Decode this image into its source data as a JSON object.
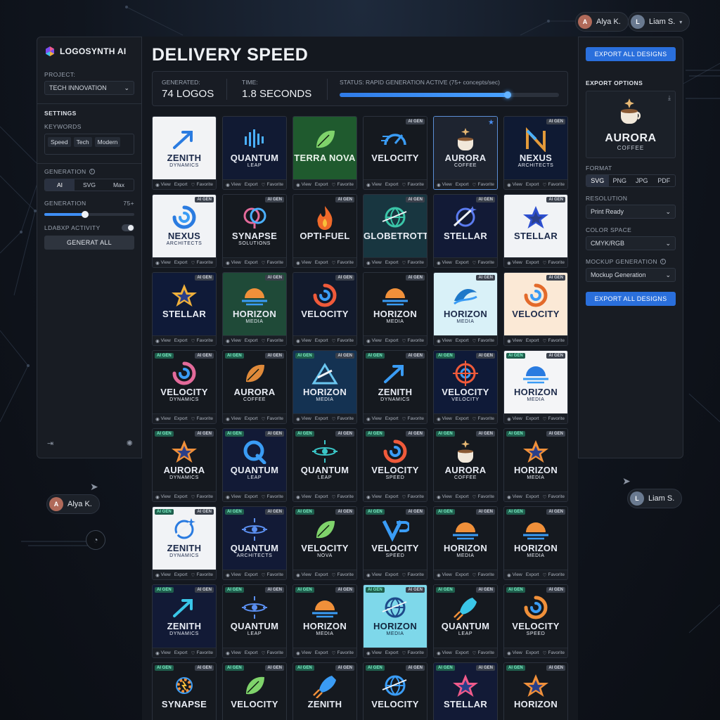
{
  "presence": {
    "top_users": [
      {
        "name": "Alya K."
      },
      {
        "name": "Liam S."
      }
    ],
    "bottom_left": "Alya K.",
    "bottom_right": "Liam S."
  },
  "sidebar": {
    "brand": "LOGOSYNTH AI",
    "project_label": "PROJECT:",
    "project_value": "TECH INNOVATION",
    "settings_label": "SETTINGS",
    "keywords_label": "KEYWORDS",
    "keywords": [
      "Speed",
      "Tech",
      "Modern"
    ],
    "generation_label": "GENERATION",
    "generation_options": [
      "AI",
      "SVG",
      "Max"
    ],
    "generation_count_label": "GENERATION",
    "generation_count_value": "75+",
    "generation_slider_fraction": 0.45,
    "activity_label": "LDABXP ACTIVITY",
    "generate_button": "GENERAT ALL"
  },
  "main": {
    "title": "DELIVERY SPEED",
    "generated_label": "GENERATED:",
    "generated_value": "74 LOGOS",
    "time_label": "TIME:",
    "time_value": "1.8 SECONDS",
    "status_label": "STATUS: RAPID GENERATION ACTIVE (75+ concepts/sec)",
    "status_progress": 0.77,
    "card_actions": {
      "view": "View",
      "export": "Export",
      "favorite": "Favorite"
    },
    "cards": [
      {
        "name": "ZENITH",
        "sub": "DYNAMICS",
        "bg": "#f2f3f5",
        "fg": "#1c2a4a",
        "accent": "#2a7be0",
        "icon": "arrow"
      },
      {
        "name": "QUANTUM",
        "sub": "LEAP",
        "bg": "#111a33",
        "fg": "#e8ecf4",
        "accent": "#4ab0ff",
        "icon": "bars"
      },
      {
        "name": "TERRA NOVA",
        "sub": "",
        "bg": "#1f5a2e",
        "fg": "#e9f4ea",
        "accent": "#7fd36b",
        "icon": "leaf"
      },
      {
        "name": "VELOCITY",
        "sub": "",
        "bg": "#15191f",
        "fg": "#e8ecf4",
        "accent": "#3a9cf5",
        "icon": "gauge",
        "tag_r": "AI GEN"
      },
      {
        "name": "AURORA",
        "sub": "COFFEE",
        "bg": "#1e2430",
        "fg": "#e8ecf4",
        "accent": "#e7b873",
        "icon": "cup",
        "selected": true
      },
      {
        "name": "NEXUS",
        "sub": "ARCHITECTS",
        "bg": "#0f1a33",
        "fg": "#e8ecf4",
        "accent": "#e39a3a",
        "icon": "n",
        "tag_r": "AI GEN"
      },
      {
        "name": "NEXUS",
        "sub": "ARCHITECTS",
        "bg": "#f1f3f6",
        "fg": "#1c2a4a",
        "accent": "#2a7be0",
        "icon": "swirl",
        "tag_r": "AI GEN"
      },
      {
        "name": "SYNAPSE",
        "sub": "SOLUTIONS",
        "bg": "#15191f",
        "fg": "#e8ecf4",
        "accent": "#e36a9a",
        "icon": "brain",
        "tag_r": "AI GEN"
      },
      {
        "name": "OPTI-FUEL",
        "sub": "",
        "bg": "#15191f",
        "fg": "#e8ecf4",
        "accent": "#f06a2a",
        "icon": "flame",
        "tag_r": "AI GEN"
      },
      {
        "name": "GLOBETROTTER",
        "sub": "",
        "bg": "#183640",
        "fg": "#e8ecf4",
        "accent": "#3ac6a8",
        "icon": "globe",
        "tag_r": "AI GEN"
      },
      {
        "name": "STELLAR",
        "sub": "",
        "bg": "#121a36",
        "fg": "#e8ecf4",
        "accent": "#5b7bf0",
        "icon": "orbit",
        "tag_r": "AI GEN"
      },
      {
        "name": "STELLAR",
        "sub": "",
        "bg": "#f1f3f6",
        "fg": "#1c2a4a",
        "accent": "#2d4fd0",
        "icon": "star",
        "tag_r": "AI GEN"
      },
      {
        "name": "STELLAR",
        "sub": "",
        "bg": "#0f1a38",
        "fg": "#e8ecf4",
        "accent": "#f0b03a",
        "icon": "star",
        "tag_r": "AI GEN"
      },
      {
        "name": "HORIZON",
        "sub": "MEDIA",
        "bg": "#1f4a38",
        "fg": "#e8ecf4",
        "accent": "#f0903a",
        "icon": "sun",
        "tag_r": "AI GEN"
      },
      {
        "name": "VELOCITY",
        "sub": "",
        "bg": "#121a2c",
        "fg": "#e8ecf4",
        "accent": "#f05a3a",
        "icon": "swirl",
        "tag_r": "AI GEN"
      },
      {
        "name": "HORIZON",
        "sub": "MEDIA",
        "bg": "#15191f",
        "fg": "#e8ecf4",
        "accent": "#f0903a",
        "icon": "sun",
        "tag_r": "AI GEN"
      },
      {
        "name": "HORIZON",
        "sub": "MEDIA",
        "bg": "#d9f1f8",
        "fg": "#1c2a4a",
        "accent": "#1e78c8",
        "icon": "wave",
        "tag_r": "AI GEN"
      },
      {
        "name": "VELOCITY",
        "sub": "",
        "bg": "#fbe9d6",
        "fg": "#1c2a4a",
        "accent": "#e36a2a",
        "icon": "swirl",
        "tag_r": "AI GEN"
      },
      {
        "name": "VELOCITY",
        "sub": "DYNAMICS",
        "bg": "#15191f",
        "fg": "#e8ecf4",
        "accent": "#e36a9a",
        "icon": "swirl",
        "tag_l": "AI GEN",
        "tag_r": "AI GEN"
      },
      {
        "name": "AURORA",
        "sub": "COFFEE",
        "bg": "#15191f",
        "fg": "#e8ecf4",
        "accent": "#e08a3a",
        "icon": "leaf",
        "tag_l": "AI GEN",
        "tag_r": "AI GEN"
      },
      {
        "name": "HORIZON",
        "sub": "MEDIA",
        "bg": "#143252",
        "fg": "#e8ecf4",
        "accent": "#6ac6f0",
        "icon": "mountain",
        "tag_l": "AI GEN",
        "tag_r": "AI GEN"
      },
      {
        "name": "ZENITH",
        "sub": "DYNAMICS",
        "bg": "#15191f",
        "fg": "#e8ecf4",
        "accent": "#3a9cf5",
        "icon": "arrow",
        "tag_l": "AI GEN",
        "tag_r": "AI GEN"
      },
      {
        "name": "VELOCITY",
        "sub": "VELOCITY",
        "bg": "#0f1a38",
        "fg": "#e8ecf4",
        "accent": "#f05a3a",
        "icon": "target",
        "tag_l": "AI GEN",
        "tag_r": "AI GEN"
      },
      {
        "name": "HORIZON",
        "sub": "MEDIA",
        "bg": "#f4f5f7",
        "fg": "#1c2a4a",
        "accent": "#2a7be0",
        "icon": "sun",
        "tag_l": "AI GEN",
        "tag_r": "AI GEN"
      },
      {
        "name": "AURORA",
        "sub": "DYNAMICS",
        "bg": "#15191f",
        "fg": "#e8ecf4",
        "accent": "#f0903a",
        "icon": "star",
        "tag_l": "AI GEN",
        "tag_r": "AI GEN"
      },
      {
        "name": "QUANTUM",
        "sub": "LEAP",
        "bg": "#121a36",
        "fg": "#e8ecf4",
        "accent": "#3a9cf5",
        "icon": "q",
        "tag_l": "AI GEN",
        "tag_r": "AI GEN"
      },
      {
        "name": "QUANTUM",
        "sub": "LEAP",
        "bg": "#15191f",
        "fg": "#e8ecf4",
        "accent": "#3ac6c8",
        "icon": "atom",
        "tag_l": "AI GEN",
        "tag_r": "AI GEN"
      },
      {
        "name": "VELOCITY",
        "sub": "SPEED",
        "bg": "#15191f",
        "fg": "#e8ecf4",
        "accent": "#f05a3a",
        "icon": "swirl",
        "tag_l": "AI GEN",
        "tag_r": "AI GEN"
      },
      {
        "name": "AURORA",
        "sub": "COFFEE",
        "bg": "#15191f",
        "fg": "#e8ecf4",
        "accent": "#e7b873",
        "icon": "cup",
        "tag_l": "AI GEN",
        "tag_r": "AI GEN"
      },
      {
        "name": "HORIZON",
        "sub": "MEDIA",
        "bg": "#15191f",
        "fg": "#e8ecf4",
        "accent": "#f0903a",
        "icon": "star",
        "tag_l": "AI GEN",
        "tag_r": "AI GEN"
      },
      {
        "name": "ZENITH",
        "sub": "DYNAMICS",
        "bg": "#f1f3f6",
        "fg": "#1c2a4a",
        "accent": "#2a7be0",
        "icon": "orbit",
        "tag_l": "AI GEN",
        "tag_r": "AI GEN"
      },
      {
        "name": "QUANTUM",
        "sub": "ARCHITECTS",
        "bg": "#121a36",
        "fg": "#e8ecf4",
        "accent": "#5b8ff0",
        "icon": "atom",
        "tag_l": "AI GEN",
        "tag_r": "AI GEN"
      },
      {
        "name": "VELOCITY",
        "sub": "NOVA",
        "bg": "#15191f",
        "fg": "#e8ecf4",
        "accent": "#7fd36b",
        "icon": "leaf",
        "tag_l": "AI GEN",
        "tag_r": "AI GEN"
      },
      {
        "name": "VELOCITY",
        "sub": "SPEED",
        "bg": "#15191f",
        "fg": "#e8ecf4",
        "accent": "#3a9cf5",
        "icon": "v",
        "tag_l": "AI GEN",
        "tag_r": "AI GEN"
      },
      {
        "name": "HORIZON",
        "sub": "MEDIA",
        "bg": "#15191f",
        "fg": "#e8ecf4",
        "accent": "#f0903a",
        "icon": "sun",
        "tag_l": "AI GEN",
        "tag_r": "AI GEN"
      },
      {
        "name": "HORIZON",
        "sub": "MEDIA",
        "bg": "#15191f",
        "fg": "#e8ecf4",
        "accent": "#f0903a",
        "icon": "sun",
        "tag_l": "AI GEN",
        "tag_r": "AI GEN"
      },
      {
        "name": "ZENITH",
        "sub": "DYNAMICS",
        "bg": "#121a36",
        "fg": "#e8ecf4",
        "accent": "#3ac6e8",
        "icon": "arrow",
        "tag_l": "AI GEN",
        "tag_r": "AI GEN"
      },
      {
        "name": "QUANTUM",
        "sub": "LEAP",
        "bg": "#15191f",
        "fg": "#e8ecf4",
        "accent": "#5b8ff0",
        "icon": "atom",
        "tag_l": "AI GEN",
        "tag_r": "AI GEN"
      },
      {
        "name": "HORIZON",
        "sub": "MEDIA",
        "bg": "#15191f",
        "fg": "#e8ecf4",
        "accent": "#f0903a",
        "icon": "sun",
        "tag_l": "AI GEN",
        "tag_r": "AI GEN"
      },
      {
        "name": "HORIZON",
        "sub": "MEDIA",
        "bg": "#7ed8ea",
        "fg": "#12263e",
        "accent": "#1e4a8a",
        "icon": "globe",
        "tag_l": "AI GEN",
        "tag_r": "AI GEN"
      },
      {
        "name": "QUANTUM",
        "sub": "LEAP",
        "bg": "#15191f",
        "fg": "#e8ecf4",
        "accent": "#3ac6e8",
        "icon": "rocket",
        "tag_l": "AI GEN",
        "tag_r": "AI GEN"
      },
      {
        "name": "VELOCITY",
        "sub": "SPEED",
        "bg": "#15191f",
        "fg": "#e8ecf4",
        "accent": "#f0903a",
        "icon": "swirl",
        "tag_l": "AI GEN",
        "tag_r": "AI GEN"
      },
      {
        "name": "SYNAPSE",
        "sub": "",
        "bg": "#15191f",
        "fg": "#e8ecf4",
        "accent": "#f0903a",
        "icon": "gear",
        "tag_l": "AI GEN",
        "tag_r": "AI GEN"
      },
      {
        "name": "VELOCITY",
        "sub": "",
        "bg": "#15191f",
        "fg": "#e8ecf4",
        "accent": "#7fd36b",
        "icon": "leaf",
        "tag_l": "AI GEN",
        "tag_r": "AI GEN"
      },
      {
        "name": "ZENITH",
        "sub": "",
        "bg": "#15191f",
        "fg": "#e8ecf4",
        "accent": "#3a9cf5",
        "icon": "rocket",
        "tag_l": "AI GEN",
        "tag_r": "AI GEN"
      },
      {
        "name": "VELOCITY",
        "sub": "",
        "bg": "#15191f",
        "fg": "#e8ecf4",
        "accent": "#3a9cf5",
        "icon": "globe",
        "tag_l": "AI GEN",
        "tag_r": "AI GEN"
      },
      {
        "name": "STELLAR",
        "sub": "",
        "bg": "#121a36",
        "fg": "#e8ecf4",
        "accent": "#f05a8a",
        "icon": "star",
        "tag_l": "AI GEN",
        "tag_r": "AI GEN"
      },
      {
        "name": "HORIZON",
        "sub": "",
        "bg": "#15191f",
        "fg": "#e8ecf4",
        "accent": "#f0903a",
        "icon": "star",
        "tag_l": "AI GEN",
        "tag_r": "AI GEN"
      }
    ]
  },
  "export": {
    "export_all_top": "EXPORT ALL DESIGNS",
    "options_label": "EXPORT OPTIONS",
    "preview_name": "AURORA",
    "preview_sub": "COFFEE",
    "format_label": "FORMAT",
    "formats": [
      "SVG",
      "PNG",
      "JPG",
      "PDF"
    ],
    "resolution_label": "RESOLUTION",
    "resolution_value": "Print Ready",
    "color_space_label": "COLOR SPACE",
    "color_space_value": "CMYK/RGB",
    "mockup_label": "MOCKUP GENERATION",
    "mockup_value": "Mockup Generation",
    "export_all_bottom": "EXPORT ALL DESIGNS"
  }
}
